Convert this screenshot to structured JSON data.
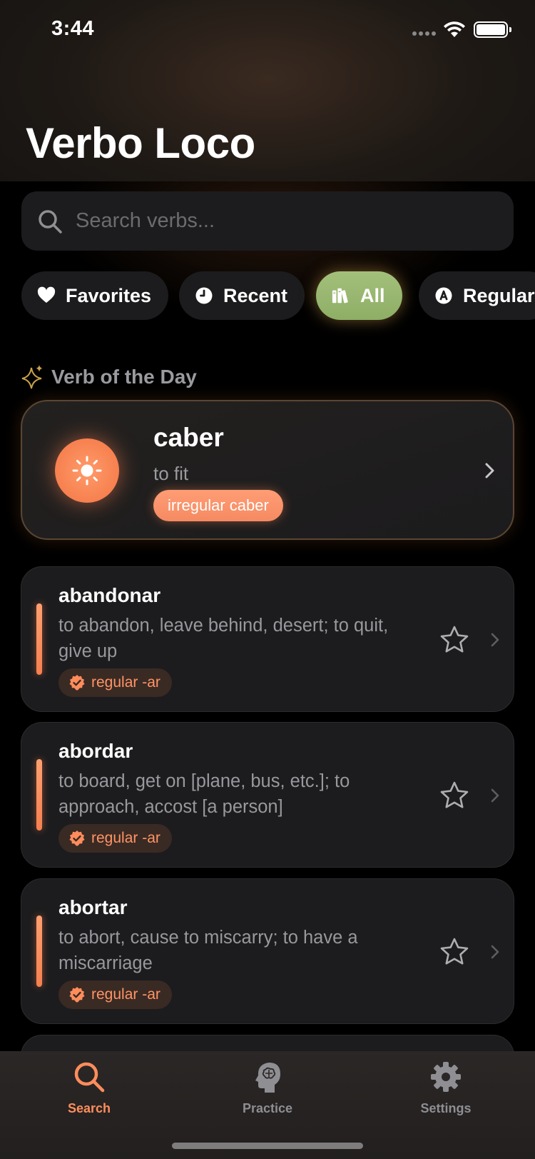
{
  "status_bar": {
    "time": "3:44"
  },
  "app": {
    "title": "Verbo Loco"
  },
  "search": {
    "placeholder": "Search verbs..."
  },
  "filters": [
    {
      "label": "Favorites",
      "icon": "heart-icon",
      "active": false
    },
    {
      "label": "Recent",
      "icon": "clock-icon",
      "active": false
    },
    {
      "label": "All",
      "icon": "books-icon",
      "active": true
    },
    {
      "label": "Regular",
      "icon": "letter-a-icon",
      "active": false
    }
  ],
  "verb_of_the_day": {
    "section_label": "Verb of the Day",
    "verb": "caber",
    "meaning": "to fit",
    "badge": "irregular caber",
    "icon": "sun-icon"
  },
  "verbs": [
    {
      "verb": "abandonar",
      "definition": "to abandon, leave behind, desert; to quit, give up",
      "tag": "regular -ar"
    },
    {
      "verb": "abordar",
      "definition": "to board, get on [plane, bus, etc.]; to approach, accost [a person]",
      "tag": "regular -ar"
    },
    {
      "verb": "abortar",
      "definition": "to abort, cause to miscarry; to have a miscarriage",
      "tag": "regular -ar"
    }
  ],
  "tabs": [
    {
      "label": "Search",
      "icon": "search-icon",
      "active": true
    },
    {
      "label": "Practice",
      "icon": "brain-head-icon",
      "active": false
    },
    {
      "label": "Settings",
      "icon": "gear-icon",
      "active": false
    }
  ],
  "colors": {
    "accent": "#f58a5a",
    "active_chip": "#9bb872",
    "card": "#1c1c1e",
    "muted_text": "#98989d",
    "tab_inactive": "#8e8e93"
  }
}
